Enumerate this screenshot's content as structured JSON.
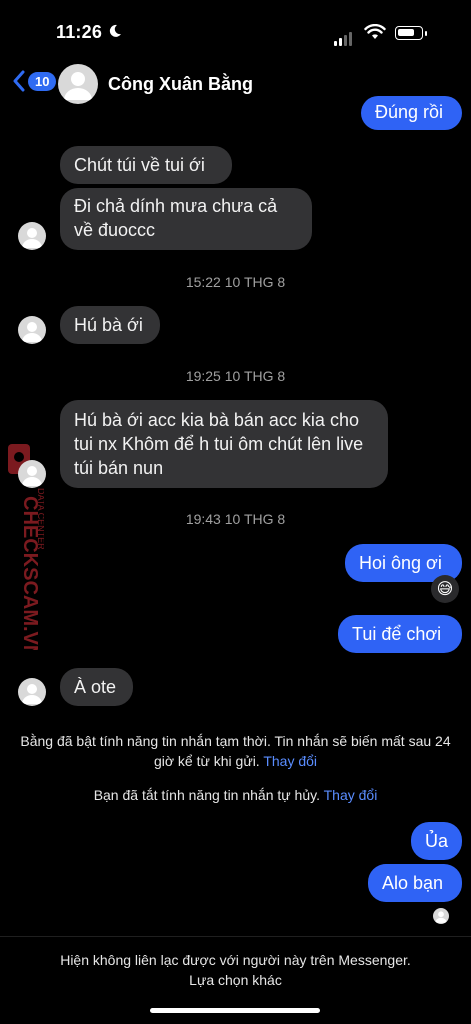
{
  "status_bar": {
    "time": "11:26"
  },
  "header": {
    "back_count": "10",
    "contact_name": "Công Xuân Bằng"
  },
  "messages": {
    "m0": "Đúng rồi",
    "m1": "Chút túi về tui ới",
    "m2": "Đi chả dính mưa chưa cả về đuoccc",
    "ts1": "15:22 10 THG 8",
    "m3": "Hú bà ới",
    "ts2": "19:25 10 THG 8",
    "m4": "Hú bà ới acc kia bà bán acc kia cho tui nx Khôm để h tui ôm chút lên live túi bán nun",
    "ts3": "19:43 10 THG 8",
    "m5": "Hoi ông ơi",
    "m5_reaction": "😅",
    "m6": "Tui để chơi",
    "m7": "À ote",
    "m8": "Ủa",
    "m9": "Alo bạn"
  },
  "system": {
    "temp_msg": "Bằng đã bật tính năng tin nhắn tạm thời. Tin nhắn sẽ biến mất sau 24 giờ kể từ khi gửi.",
    "temp_change": "Thay đổi",
    "self_destruct": "Bạn đã tắt tính năng tin nhắn tự hủy.",
    "self_change": "Thay đổi"
  },
  "footer": {
    "notice": "Hiện không liên lạc được với người này trên Messenger.",
    "option": "Lựa chọn khác"
  },
  "watermark": {
    "text": "CHECKSCAM.VN",
    "subtext": "DATA CENTER"
  },
  "colors": {
    "outgoing": "#2f63f5",
    "incoming": "#333335",
    "link": "#5a8dff",
    "background": "#000000"
  }
}
